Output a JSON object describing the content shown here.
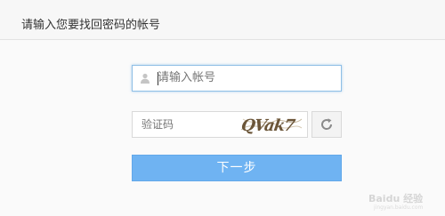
{
  "header": {
    "title": "请输入您要找回密码的帐号"
  },
  "form": {
    "account": {
      "value": "",
      "placeholder": "请输入帐号"
    },
    "captcha": {
      "value": "",
      "placeholder": "验证码",
      "image_text": "QVak7"
    },
    "next_label": "下一步"
  },
  "icons": {
    "account": "user-icon",
    "refresh": "refresh-icon"
  },
  "watermark": {
    "text": "Baidu 经验",
    "subtext": "jingyan.baidu.com"
  },
  "colors": {
    "accent": "#6fb3f2",
    "focus_border": "#8fbfe6"
  }
}
